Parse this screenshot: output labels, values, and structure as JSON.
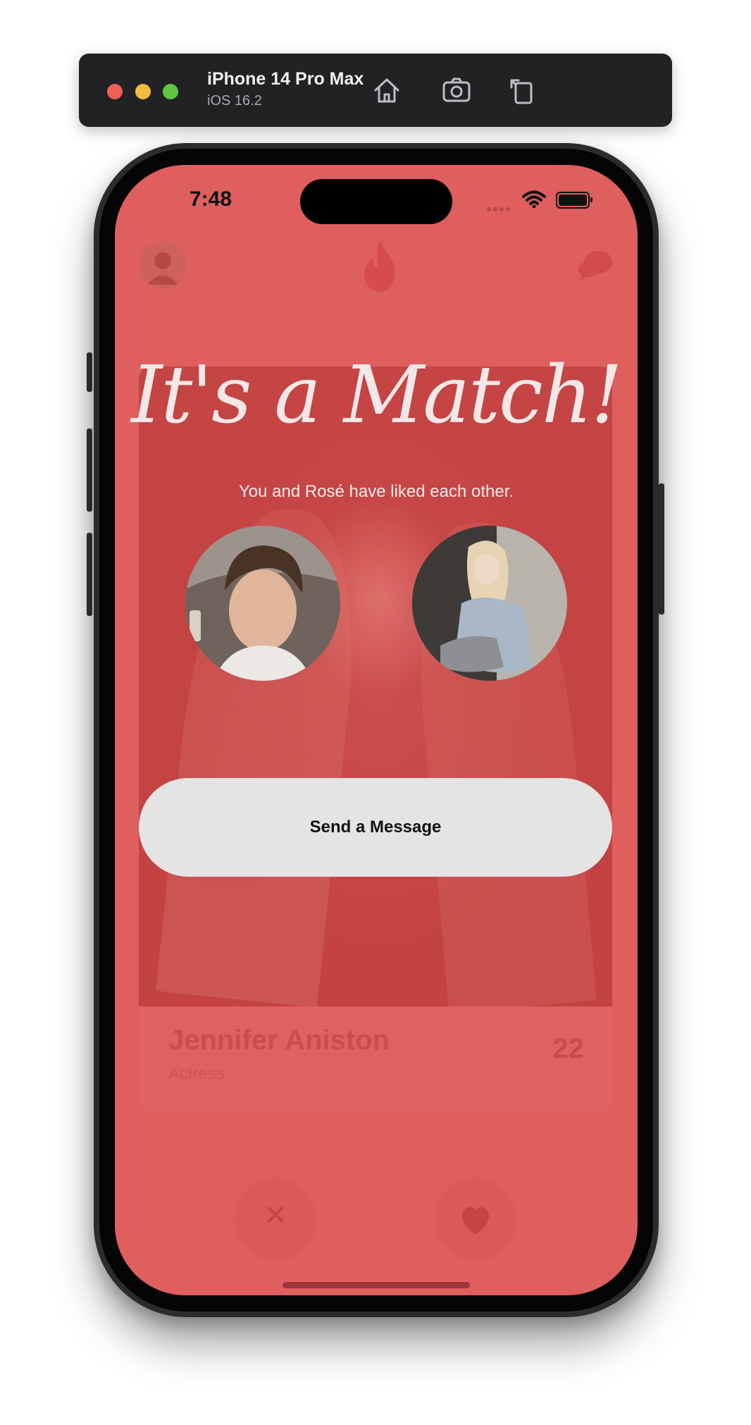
{
  "simulator": {
    "device_name": "iPhone 14 Pro Max",
    "os_version": "iOS 16.2",
    "icons": [
      "home-icon",
      "screenshot-icon",
      "rotate-icon"
    ]
  },
  "status_bar": {
    "time": "7:48",
    "icons": [
      "signal-icon",
      "wifi-icon",
      "battery-icon"
    ]
  },
  "app_header": {
    "icons": [
      "profile-avatar",
      "flame-icon",
      "chat-icon"
    ]
  },
  "card": {
    "name": "Jennifer Aniston",
    "occupation": "Actress",
    "age": "22"
  },
  "actions": {
    "dislike_glyph": "✕",
    "icons": [
      "close-icon",
      "heart-icon"
    ]
  },
  "match": {
    "title": "It's a Match!",
    "subtitle": "You and Rosé have liked each other.",
    "send_button": "Send a Message"
  },
  "colors": {
    "screen_bg": "#df5e5e",
    "card_photo": "#c44545",
    "button_bg": "#e4e4e5"
  }
}
